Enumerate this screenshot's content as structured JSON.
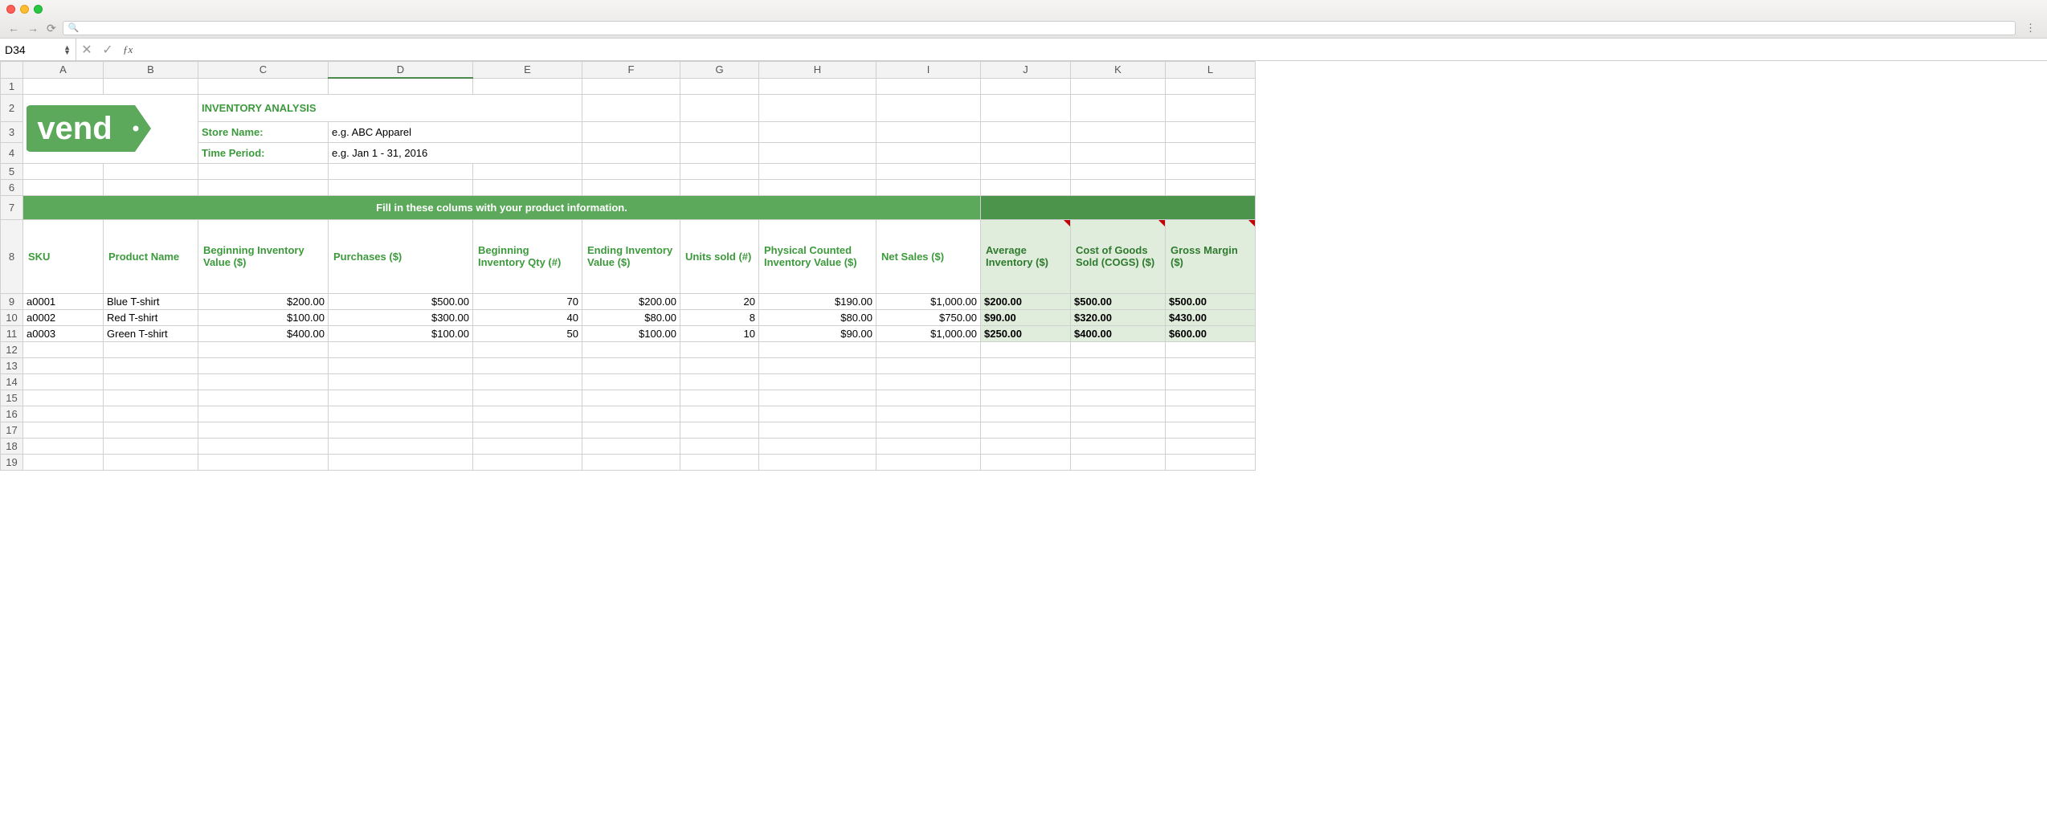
{
  "browser": {
    "url_placeholder": ""
  },
  "formula_bar": {
    "cell_ref": "D34",
    "formula": ""
  },
  "columns": [
    "A",
    "B",
    "C",
    "D",
    "E",
    "F",
    "G",
    "H",
    "I",
    "J",
    "K",
    "L"
  ],
  "logo_text": "vend",
  "header": {
    "title": "INVENTORY ANALYSIS",
    "store_label": "Store Name:",
    "store_value": "e.g. ABC Apparel",
    "period_label": "Time Period:",
    "period_value": "e.g. Jan 1 - 31, 2016"
  },
  "banner_text": "Fill in these colums with your product information.",
  "col_headers": {
    "sku": "SKU",
    "product_name": "Product Name",
    "beg_inv_val": "Beginning Inventory Value ($)",
    "purchases": "Purchases ($)",
    "beg_inv_qty": "Beginning Inventory Qty (#)",
    "end_inv_val": "Ending Inventory Value ($)",
    "units_sold": "Units sold (#)",
    "phys_count": "Physical Counted Inventory Value ($)",
    "net_sales": "Net Sales ($)",
    "avg_inv": "Average Inventory ($)",
    "cogs": "Cost of Goods Sold (COGS) ($)",
    "gross_margin": "Gross Margin ($)"
  },
  "rows": [
    {
      "sku": "a0001",
      "name": "Blue T-shirt",
      "beg_val": "$200.00",
      "purch": "$500.00",
      "beg_qty": "70",
      "end_val": "$200.00",
      "units": "20",
      "phys": "$190.00",
      "net": "$1,000.00",
      "avg": "$200.00",
      "cogs": "$500.00",
      "gm": "$500.00"
    },
    {
      "sku": "a0002",
      "name": "Red T-shirt",
      "beg_val": "$100.00",
      "purch": "$300.00",
      "beg_qty": "40",
      "end_val": "$80.00",
      "units": "8",
      "phys": "$80.00",
      "net": "$750.00",
      "avg": "$90.00",
      "cogs": "$320.00",
      "gm": "$430.00"
    },
    {
      "sku": "a0003",
      "name": "Green T-shirt",
      "beg_val": "$400.00",
      "purch": "$100.00",
      "beg_qty": "50",
      "end_val": "$100.00",
      "units": "10",
      "phys": "$90.00",
      "net": "$1,000.00",
      "avg": "$250.00",
      "cogs": "$400.00",
      "gm": "$600.00"
    }
  ],
  "chart_data": {
    "type": "table",
    "title": "INVENTORY ANALYSIS",
    "columns": [
      "SKU",
      "Product Name",
      "Beginning Inventory Value ($)",
      "Purchases ($)",
      "Beginning Inventory Qty (#)",
      "Ending Inventory Value ($)",
      "Units sold (#)",
      "Physical Counted Inventory Value ($)",
      "Net Sales ($)",
      "Average Inventory ($)",
      "Cost of Goods Sold (COGS) ($)",
      "Gross Margin ($)"
    ],
    "rows": [
      [
        "a0001",
        "Blue T-shirt",
        200.0,
        500.0,
        70,
        200.0,
        20,
        190.0,
        1000.0,
        200.0,
        500.0,
        500.0
      ],
      [
        "a0002",
        "Red T-shirt",
        100.0,
        300.0,
        40,
        80.0,
        8,
        80.0,
        750.0,
        90.0,
        320.0,
        430.0
      ],
      [
        "a0003",
        "Green T-shirt",
        400.0,
        100.0,
        50,
        100.0,
        10,
        90.0,
        1000.0,
        250.0,
        400.0,
        600.0
      ]
    ]
  }
}
